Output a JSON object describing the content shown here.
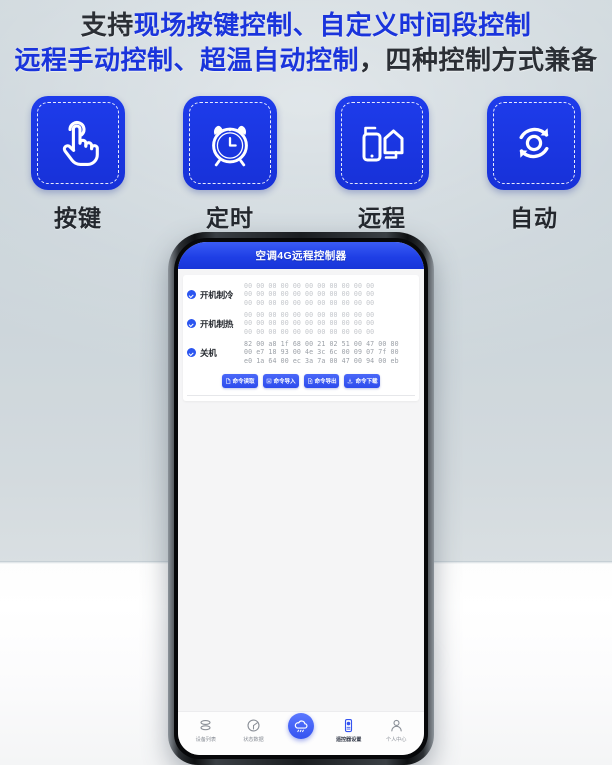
{
  "headline": {
    "line1_prefix": "支持",
    "line1_highlight": "现场按键控制、自定义时间段控制",
    "line2_highlight": "远程手动控制、超温自动控制",
    "line2_suffix": "，四种控制方式兼备"
  },
  "colors": {
    "brand_blue": "#1e3ceb",
    "headline_blue": "#1a34dc",
    "headline_dark": "#2b2f35",
    "header_gradient_start": "#3a5cf5",
    "header_gradient_end": "#1835d8",
    "button_blue": "#2d4ced",
    "check_blue": "#2b55f0",
    "hex_text": "#c3c6cb",
    "screen_bg": "#f5f5f6",
    "wall": "#cfd8dd",
    "floor": "#ffffff"
  },
  "features": [
    {
      "icon": "tap-finger-icon",
      "label": "按键"
    },
    {
      "icon": "alarm-clock-icon",
      "label": "定时"
    },
    {
      "icon": "phone-house-remote-icon",
      "label": "远程"
    },
    {
      "icon": "auto-refresh-icon",
      "label": "自动"
    }
  ],
  "phone_app": {
    "header": {
      "title": "空调4G远程控制器"
    },
    "commands": [
      {
        "checked": true,
        "name": "开机制冷",
        "hex_lines": [
          "00 00 00 00 00 00 00 00 00 00 00",
          "00 00 00 00 00 00 00 00 00 00 00",
          "00 00 00 00 00 00 00 00 00 00 00"
        ]
      },
      {
        "checked": true,
        "name": "开机制热",
        "hex_lines": [
          "00 00 00 00 00 00 00 00 00 00 00",
          "00 00 00 00 00 00 00 00 00 00 00",
          "00 00 00 00 00 00 00 00 00 00 00"
        ]
      },
      {
        "checked": true,
        "name": "关机",
        "hex_lines": [
          "82 00 a8 1f 68 00 21 02 51 00 47 00 80",
          "00 e7 18 93 00 4e 3c 6c 00 09 07 7f 00",
          "e0 1a 64 00 ec 3a 7a 00 47 00 94 00 eb"
        ]
      }
    ],
    "actions": [
      {
        "icon": "file-read-icon",
        "label": "命令读取"
      },
      {
        "icon": "file-import-icon",
        "label": "命令导入"
      },
      {
        "icon": "file-export-icon",
        "label": "命令导出"
      },
      {
        "icon": "file-download-icon",
        "label": "命令下载"
      }
    ],
    "nav": [
      {
        "icon": "device-list-icon",
        "label": "设备列表",
        "active": false
      },
      {
        "icon": "status-data-icon",
        "label": "状态数据",
        "active": false
      },
      {
        "icon": "cloud-control-icon",
        "label": "",
        "active": true,
        "center": true
      },
      {
        "icon": "remote-settings-icon",
        "label": "遥控器设置",
        "active": true
      },
      {
        "icon": "person-icon",
        "label": "个人中心",
        "active": false
      }
    ]
  }
}
